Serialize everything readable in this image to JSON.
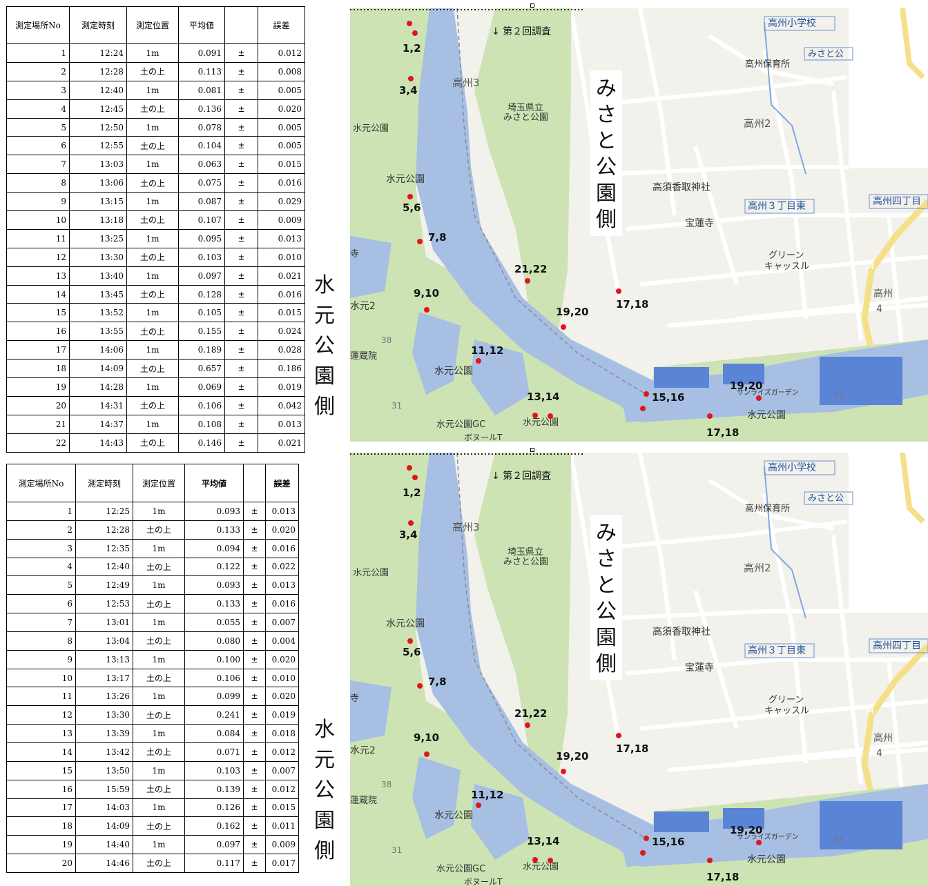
{
  "headers": [
    "測定場所No",
    "測定時刻",
    "測定位置",
    "平均値",
    "",
    "誤差"
  ],
  "table1": [
    [
      "1",
      "12:24",
      "1m",
      "0.091",
      "±",
      "0.012"
    ],
    [
      "2",
      "12:28",
      "土の上",
      "0.113",
      "±",
      "0.008"
    ],
    [
      "3",
      "12:40",
      "1m",
      "0.081",
      "±",
      "0.005"
    ],
    [
      "4",
      "12:45",
      "土の上",
      "0.136",
      "±",
      "0.020"
    ],
    [
      "5",
      "12:50",
      "1m",
      "0.078",
      "±",
      "0.005"
    ],
    [
      "6",
      "12:55",
      "土の上",
      "0.104",
      "±",
      "0.005"
    ],
    [
      "7",
      "13:03",
      "1m",
      "0.063",
      "±",
      "0.015"
    ],
    [
      "8",
      "13:06",
      "土の上",
      "0.075",
      "±",
      "0.016"
    ],
    [
      "9",
      "13:15",
      "1m",
      "0.087",
      "±",
      "0.029"
    ],
    [
      "10",
      "13:18",
      "土の上",
      "0.107",
      "±",
      "0.009"
    ],
    [
      "11",
      "13:25",
      "1m",
      "0.095",
      "±",
      "0.013"
    ],
    [
      "12",
      "13:30",
      "土の上",
      "0.103",
      "±",
      "0.010"
    ],
    [
      "13",
      "13:40",
      "1m",
      "0.097",
      "±",
      "0.021"
    ],
    [
      "14",
      "13:45",
      "土の上",
      "0.128",
      "±",
      "0.016"
    ],
    [
      "15",
      "13:52",
      "1m",
      "0.105",
      "±",
      "0.015"
    ],
    [
      "16",
      "13:55",
      "土の上",
      "0.155",
      "±",
      "0.024"
    ],
    [
      "17",
      "14:06",
      "1m",
      "0.189",
      "±",
      "0.028"
    ],
    [
      "18",
      "14:09",
      "土の上",
      "0.657",
      "±",
      "0.186"
    ],
    [
      "19",
      "14:28",
      "1m",
      "0.069",
      "±",
      "0.019"
    ],
    [
      "20",
      "14:31",
      "土の上",
      "0.106",
      "±",
      "0.042"
    ],
    [
      "21",
      "14:37",
      "1m",
      "0.108",
      "±",
      "0.013"
    ],
    [
      "22",
      "14:43",
      "土の上",
      "0.146",
      "±",
      "0.021"
    ]
  ],
  "table2": [
    [
      "1",
      "12:25",
      "1m",
      "0.093",
      "±",
      "0.013"
    ],
    [
      "2",
      "12:28",
      "土の上",
      "0.133",
      "±",
      "0.020"
    ],
    [
      "3",
      "12:35",
      "1m",
      "0.094",
      "±",
      "0.016"
    ],
    [
      "4",
      "12:40",
      "土の上",
      "0.122",
      "±",
      "0.022"
    ],
    [
      "5",
      "12:49",
      "1m",
      "0.093",
      "±",
      "0.013"
    ],
    [
      "6",
      "12:53",
      "土の上",
      "0.133",
      "±",
      "0.016"
    ],
    [
      "7",
      "13:01",
      "1m",
      "0.055",
      "±",
      "0.007"
    ],
    [
      "8",
      "13:04",
      "土の上",
      "0.080",
      "±",
      "0.004"
    ],
    [
      "9",
      "13:13",
      "1m",
      "0.100",
      "±",
      "0.020"
    ],
    [
      "10",
      "13:17",
      "土の上",
      "0.106",
      "±",
      "0.010"
    ],
    [
      "11",
      "13:26",
      "1m",
      "0.099",
      "±",
      "0.020"
    ],
    [
      "12",
      "13:30",
      "土の上",
      "0.241",
      "±",
      "0.019"
    ],
    [
      "13",
      "13:39",
      "1m",
      "0.084",
      "±",
      "0.018"
    ],
    [
      "14",
      "13:42",
      "土の上",
      "0.071",
      "±",
      "0.012"
    ],
    [
      "15",
      "13:50",
      "1m",
      "0.103",
      "±",
      "0.007"
    ],
    [
      "16",
      "15:59",
      "土の上",
      "0.139",
      "±",
      "0.012"
    ],
    [
      "17",
      "14:03",
      "1m",
      "0.126",
      "±",
      "0.015"
    ],
    [
      "18",
      "14:09",
      "土の上",
      "0.162",
      "±",
      "0.011"
    ],
    [
      "19",
      "14:40",
      "1m",
      "0.097",
      "±",
      "0.009"
    ],
    [
      "20",
      "14:46",
      "土の上",
      "0.117",
      "±",
      "0.017"
    ]
  ],
  "side_label_left": "水元公園側",
  "side_label_right": "みさと公園側",
  "map": {
    "survey_note": "↓ 第２回調査",
    "point_labels": [
      "1,2",
      "3,4",
      "5,6",
      "7,8",
      "9,10",
      "11,12",
      "13,14",
      "15,16",
      "17,18",
      "19,20",
      "21,22",
      "19,20",
      "17,18"
    ],
    "place_labels": [
      "高州小学校",
      "サンライズガーデン",
      "みさと公",
      "高州保育所",
      "高州3",
      "埼玉県立",
      "みさと公園",
      "水元公園",
      "高州2",
      "水元公園",
      "高須香取神社",
      "高州３丁目東",
      "高州四丁目",
      "宝蓮寺",
      "グリーン",
      "キャッスル",
      "水元2",
      "蓮蔵院",
      "水元公園",
      "水元公園",
      "水元公園GC",
      "水元公園",
      "ボヌールT",
      "高州",
      "4",
      "38",
      "31",
      "54",
      "54",
      "寺"
    ],
    "colors": {
      "water": "#a6bfe3",
      "park": "#cde3b4",
      "land": "#f2f1ec",
      "point": "#e0161c",
      "road": "#ffffff"
    }
  }
}
